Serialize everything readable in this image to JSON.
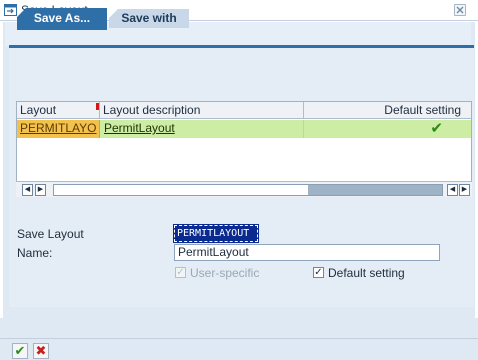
{
  "window": {
    "title": "Save Layout",
    "close_icon": "close-icon"
  },
  "tabs": [
    {
      "label": "Save As...",
      "active": true
    },
    {
      "label": "Save with",
      "active": false
    }
  ],
  "table": {
    "columns": [
      "Layout",
      "Layout description",
      "Default setting"
    ],
    "rows": [
      {
        "layout": "PERMITLAYO",
        "description": "PermitLayout",
        "default_setting": "✔"
      }
    ]
  },
  "form": {
    "save_layout_label": "Save Layout",
    "save_layout_value": "PERMITLAYOUT",
    "name_label": "Name:",
    "name_value": "PermitLayout",
    "user_specific_label": "User-specific",
    "user_specific_checked": true,
    "user_specific_disabled": true,
    "default_setting_label": "Default setting",
    "default_setting_checked": true
  },
  "footer": {
    "ok_symbol": "✔",
    "cancel_symbol": "✖"
  },
  "colors": {
    "tab_active": "#2f6fa8",
    "row_highlight": "#cdeca4",
    "cell_selected": "#f3c24d",
    "input_selected": "#0a2a8f"
  }
}
